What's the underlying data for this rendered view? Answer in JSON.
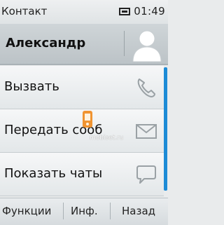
{
  "status": {
    "title": "Контакт",
    "time": "01:49",
    "icon": "message-icon"
  },
  "contact": {
    "name": "Александр",
    "avatar_icon": "person-silhouette-icon"
  },
  "menu": [
    {
      "label": "Вызвать",
      "icon": "phone-icon"
    },
    {
      "label": "Передать сооб",
      "icon": "envelope-icon"
    },
    {
      "label": "Показать чаты",
      "icon": "chat-bubble-icon"
    }
  ],
  "watermark": "mobiset.ru",
  "softkeys": {
    "left": "Функции",
    "middle": "Инф.",
    "right": "Назад"
  },
  "colors": {
    "scrollbar": "#1d8bd6",
    "header": "#c5cbcf"
  }
}
